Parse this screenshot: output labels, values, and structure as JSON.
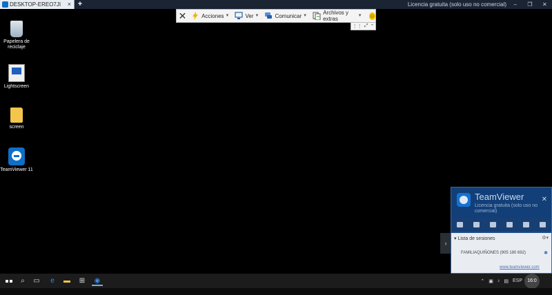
{
  "tab": {
    "title": "DESKTOP-EREO7JI",
    "close": "×",
    "newtab": "+"
  },
  "license_top": "Licencia gratuita (solo uso no comercial)",
  "window_controls": [
    "–",
    "❐",
    "✕"
  ],
  "toolbar": {
    "close": "✕",
    "items": [
      {
        "label": "Acciones",
        "icon": "lightning-icon"
      },
      {
        "label": "Ver",
        "icon": "monitor-icon"
      },
      {
        "label": "Comunicar",
        "icon": "chat-icon"
      },
      {
        "label": "Archivos y extras",
        "icon": "files-icon"
      }
    ]
  },
  "desktop_icons": [
    {
      "label": "Papelera de reciclaje"
    },
    {
      "label": "Lightscreen"
    },
    {
      "label": "screen"
    },
    {
      "label": "TeamViewer 11"
    }
  ],
  "teamviewer_panel": {
    "brand": "TeamViewer",
    "license": "Licencia gratuita (solo uso no comercial)",
    "close": "✕",
    "sessions_title": "Lista de sesiones",
    "session_row": "FAMILIAQUIÑONES (905 180 692)",
    "url": "www.teamviewer.com"
  },
  "taskbar": {
    "lang": "ESP",
    "time": "16:0"
  },
  "colors": {
    "accent": "#0e6fc7",
    "panel": "#1b4e8c",
    "taskbar": "#1c1c1c"
  }
}
